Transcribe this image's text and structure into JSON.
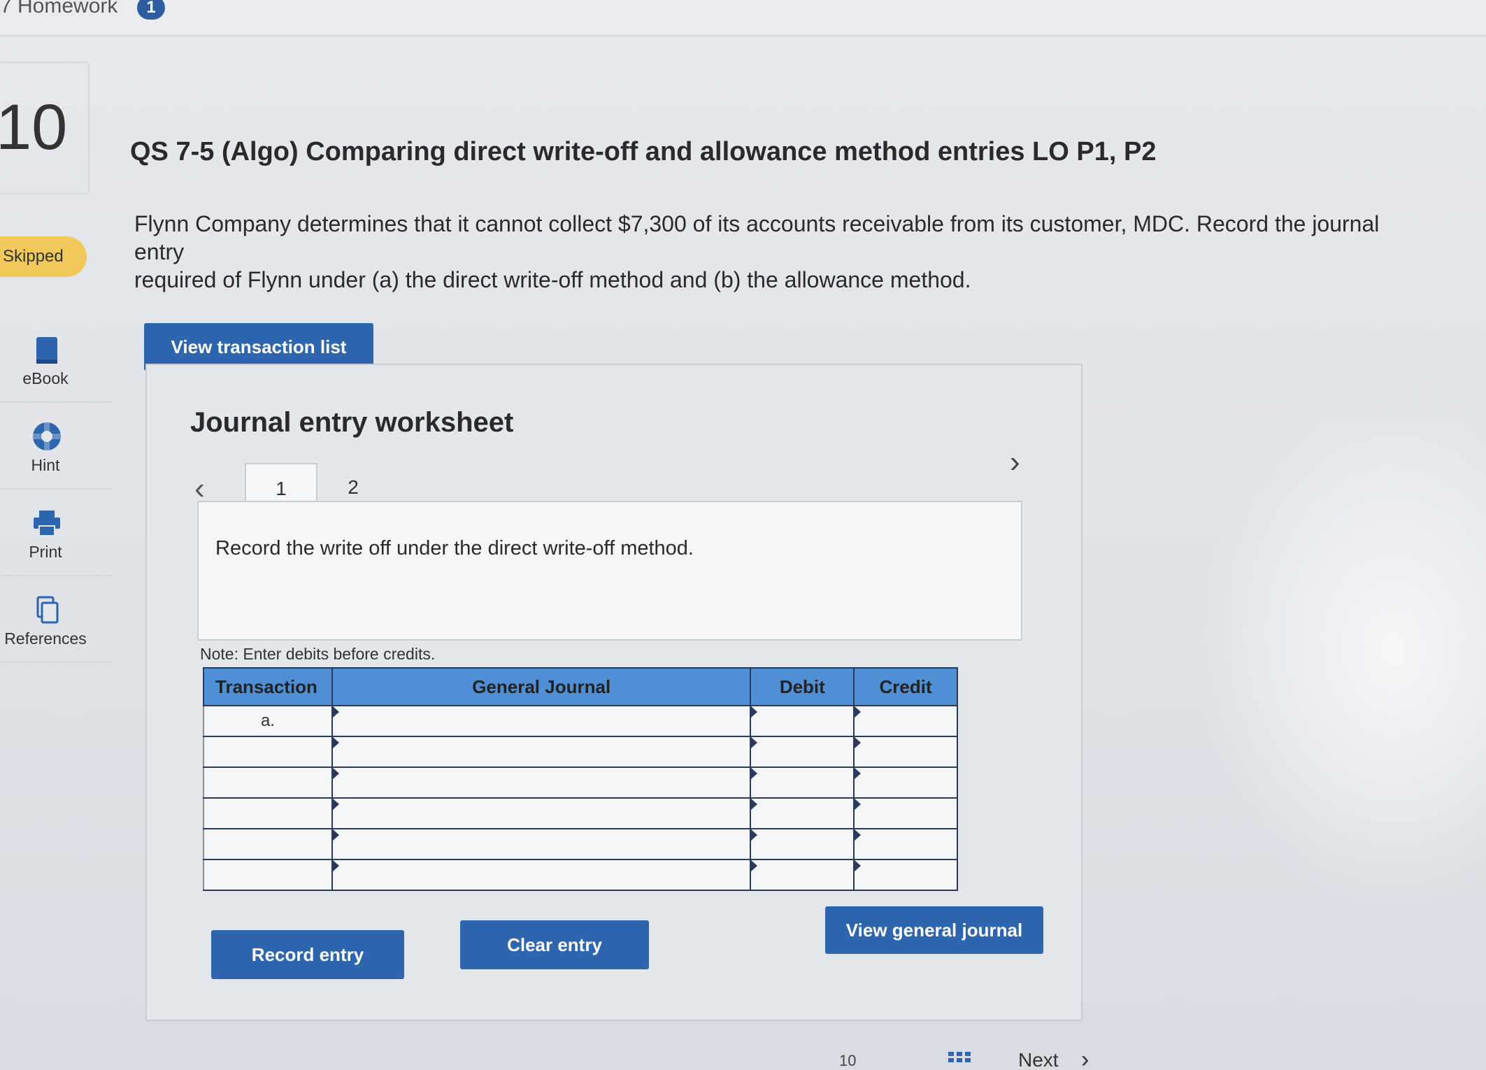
{
  "header": {
    "assignment_title": "7 Homework",
    "assignment_badge": "1"
  },
  "question": {
    "number": "10",
    "status": "Skipped",
    "title": "QS 7-5 (Algo) Comparing direct write-off and allowance method entries LO P1, P2",
    "body_line1": "Flynn Company determines that it cannot collect $7,300 of its accounts receivable from its customer, MDC. Record the journal entry",
    "body_line2": "required of Flynn under (a) the direct write-off method and (b) the allowance method."
  },
  "tools": [
    {
      "label": "eBook",
      "icon": "book-icon"
    },
    {
      "label": "Hint",
      "icon": "lifebuoy-icon"
    },
    {
      "label": "Print",
      "icon": "printer-icon"
    },
    {
      "label": "References",
      "icon": "copy-icon"
    }
  ],
  "buttons": {
    "view_transaction_list": "View transaction list",
    "record_entry": "Record entry",
    "clear_entry": "Clear entry",
    "view_general_journal": "View general journal"
  },
  "worksheet": {
    "title": "Journal entry worksheet",
    "tabs": [
      "1",
      "2"
    ],
    "active_tab": "1",
    "instruction": "Record the write off under the direct write-off method.",
    "note": "Note: Enter debits before credits.",
    "columns": [
      "Transaction",
      "General Journal",
      "Debit",
      "Credit"
    ],
    "rows": [
      {
        "transaction": "a.",
        "general_journal": "",
        "debit": "",
        "credit": ""
      },
      {
        "transaction": "",
        "general_journal": "",
        "debit": "",
        "credit": ""
      },
      {
        "transaction": "",
        "general_journal": "",
        "debit": "",
        "credit": ""
      },
      {
        "transaction": "",
        "general_journal": "",
        "debit": "",
        "credit": ""
      },
      {
        "transaction": "",
        "general_journal": "",
        "debit": "",
        "credit": ""
      },
      {
        "transaction": "",
        "general_journal": "",
        "debit": "",
        "credit": ""
      }
    ]
  },
  "footer": {
    "page_indicator": "10",
    "next_label": "Next"
  },
  "colors": {
    "primary_button": "#2d66ae",
    "table_header": "#4f8fd6",
    "status_skipped": "#f0c95a"
  }
}
